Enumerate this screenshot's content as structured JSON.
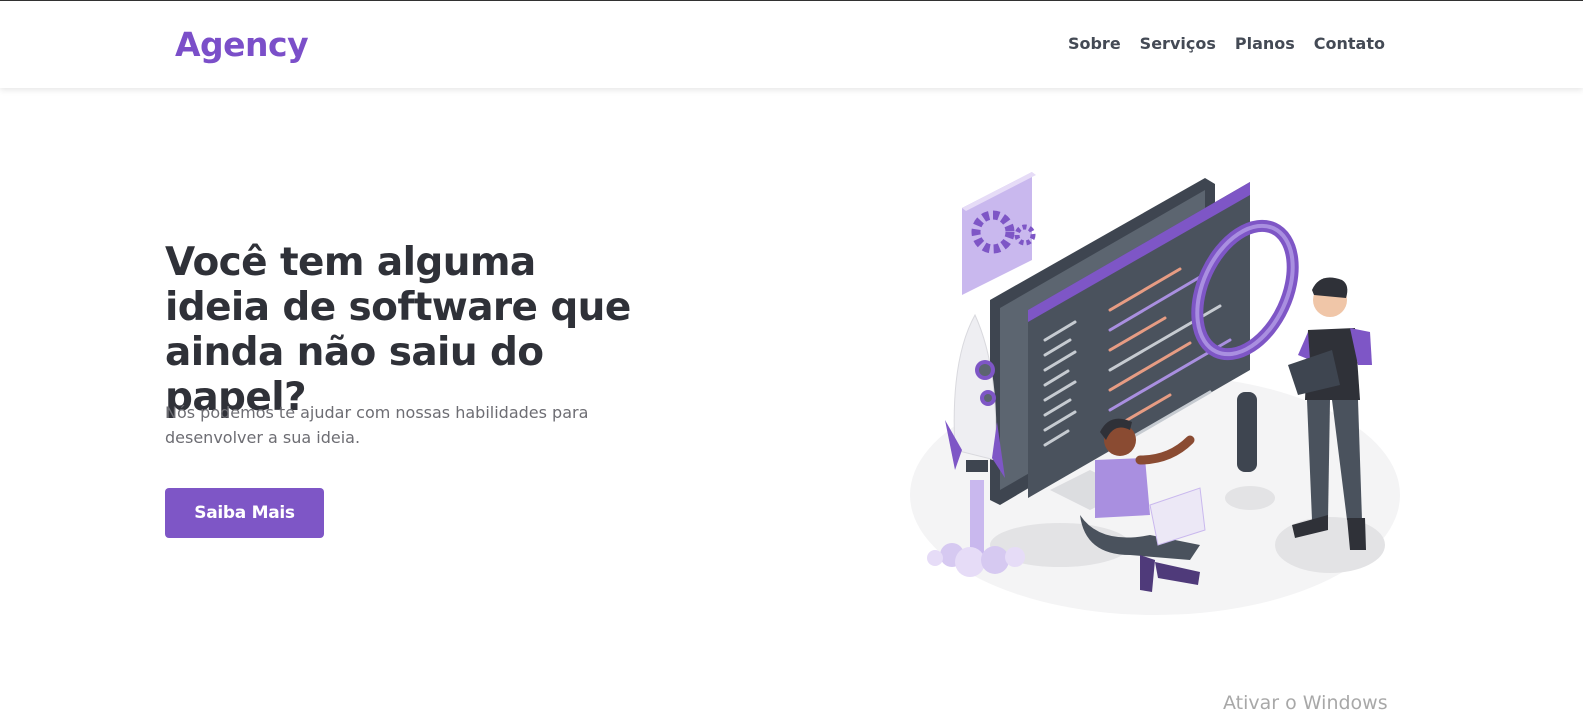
{
  "header": {
    "logo": "Agency",
    "nav": [
      "Sobre",
      "Serviços",
      "Planos",
      "Contato"
    ]
  },
  "hero": {
    "title": "Você tem alguma ideia de software que ainda não saiu do papel?",
    "subtitle": "Nós podemos te ajudar com nossas habilidades para desenvolver a sua ideia.",
    "cta_label": "Saiba Mais"
  },
  "system": {
    "watermark": "Ativar o Windows"
  },
  "colors": {
    "brand": "#7b4fc9",
    "button": "#7e56c6",
    "text_dark": "#2f3138",
    "text_muted": "#6d6d73"
  }
}
